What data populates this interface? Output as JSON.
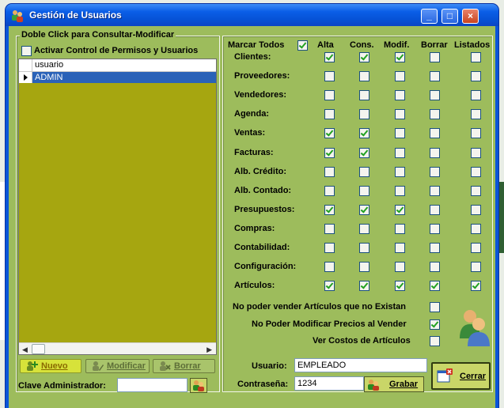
{
  "window": {
    "title": "Gestión de Usuarios",
    "min": "_",
    "max": "□",
    "close": "×"
  },
  "left": {
    "group_title": "Doble Click para Consultar-Modificar",
    "activate_label": "Activar Control de Permisos y Usuarios",
    "activate_checked": false,
    "grid_header": "usuario",
    "grid_rows": [
      "ADMIN"
    ],
    "buttons": {
      "nuevo": "Nuevo",
      "modificar": "Modificar",
      "borrar": "Borrar"
    },
    "admin_key_label": "Clave Administrador:",
    "admin_key_value": ""
  },
  "permissions": {
    "marcar_todos_label": "Marcar Todos",
    "marcar_todos_checked": true,
    "columns": [
      "Alta",
      "Cons.",
      "Modif.",
      "Borrar",
      "Listados"
    ],
    "rows": [
      {
        "label": "Clientes:",
        "checks": [
          true,
          true,
          true,
          false,
          false
        ]
      },
      {
        "label": "Proveedores:",
        "checks": [
          false,
          false,
          false,
          false,
          false
        ]
      },
      {
        "label": "Vendedores:",
        "checks": [
          false,
          false,
          false,
          false,
          false
        ]
      },
      {
        "label": "Agenda:",
        "checks": [
          false,
          false,
          false,
          false,
          false
        ]
      },
      {
        "label": "Ventas:",
        "checks": [
          true,
          true,
          false,
          false,
          false
        ]
      },
      {
        "label": "Facturas:",
        "checks": [
          true,
          true,
          false,
          false,
          false
        ]
      },
      {
        "label": "Alb. Crédito:",
        "checks": [
          false,
          false,
          false,
          false,
          false
        ]
      },
      {
        "label": "Alb. Contado:",
        "checks": [
          false,
          false,
          false,
          false,
          false
        ]
      },
      {
        "label": "Presupuestos:",
        "checks": [
          true,
          true,
          true,
          false,
          false
        ]
      },
      {
        "label": "Compras:",
        "checks": [
          false,
          false,
          false,
          false,
          false
        ]
      },
      {
        "label": "Contabilidad:",
        "checks": [
          false,
          false,
          false,
          false,
          false
        ]
      },
      {
        "label": "Configuración:",
        "checks": [
          false,
          false,
          false,
          false,
          false
        ]
      },
      {
        "label": "Artículos:",
        "checks": [
          true,
          true,
          true,
          true,
          true
        ]
      }
    ],
    "options": [
      {
        "label": "No poder vender Artículos que no Existan",
        "checked": false
      },
      {
        "label": "No Poder Modificar Precios al Vender",
        "checked": true
      },
      {
        "label": "Ver Costos de Artículos",
        "checked": false
      }
    ],
    "usuario_label": "Usuario:",
    "usuario_value": "EMPLEADO",
    "password_label": "Contraseña:",
    "password_value": "1234",
    "grabar_label": "Grabar",
    "cerrar_label": "Cerrar"
  },
  "colors": {
    "panel": "#9dbc5c",
    "grid": "#a6a610",
    "selection": "#2a62b8",
    "titlebar": "#0a5ee7"
  }
}
